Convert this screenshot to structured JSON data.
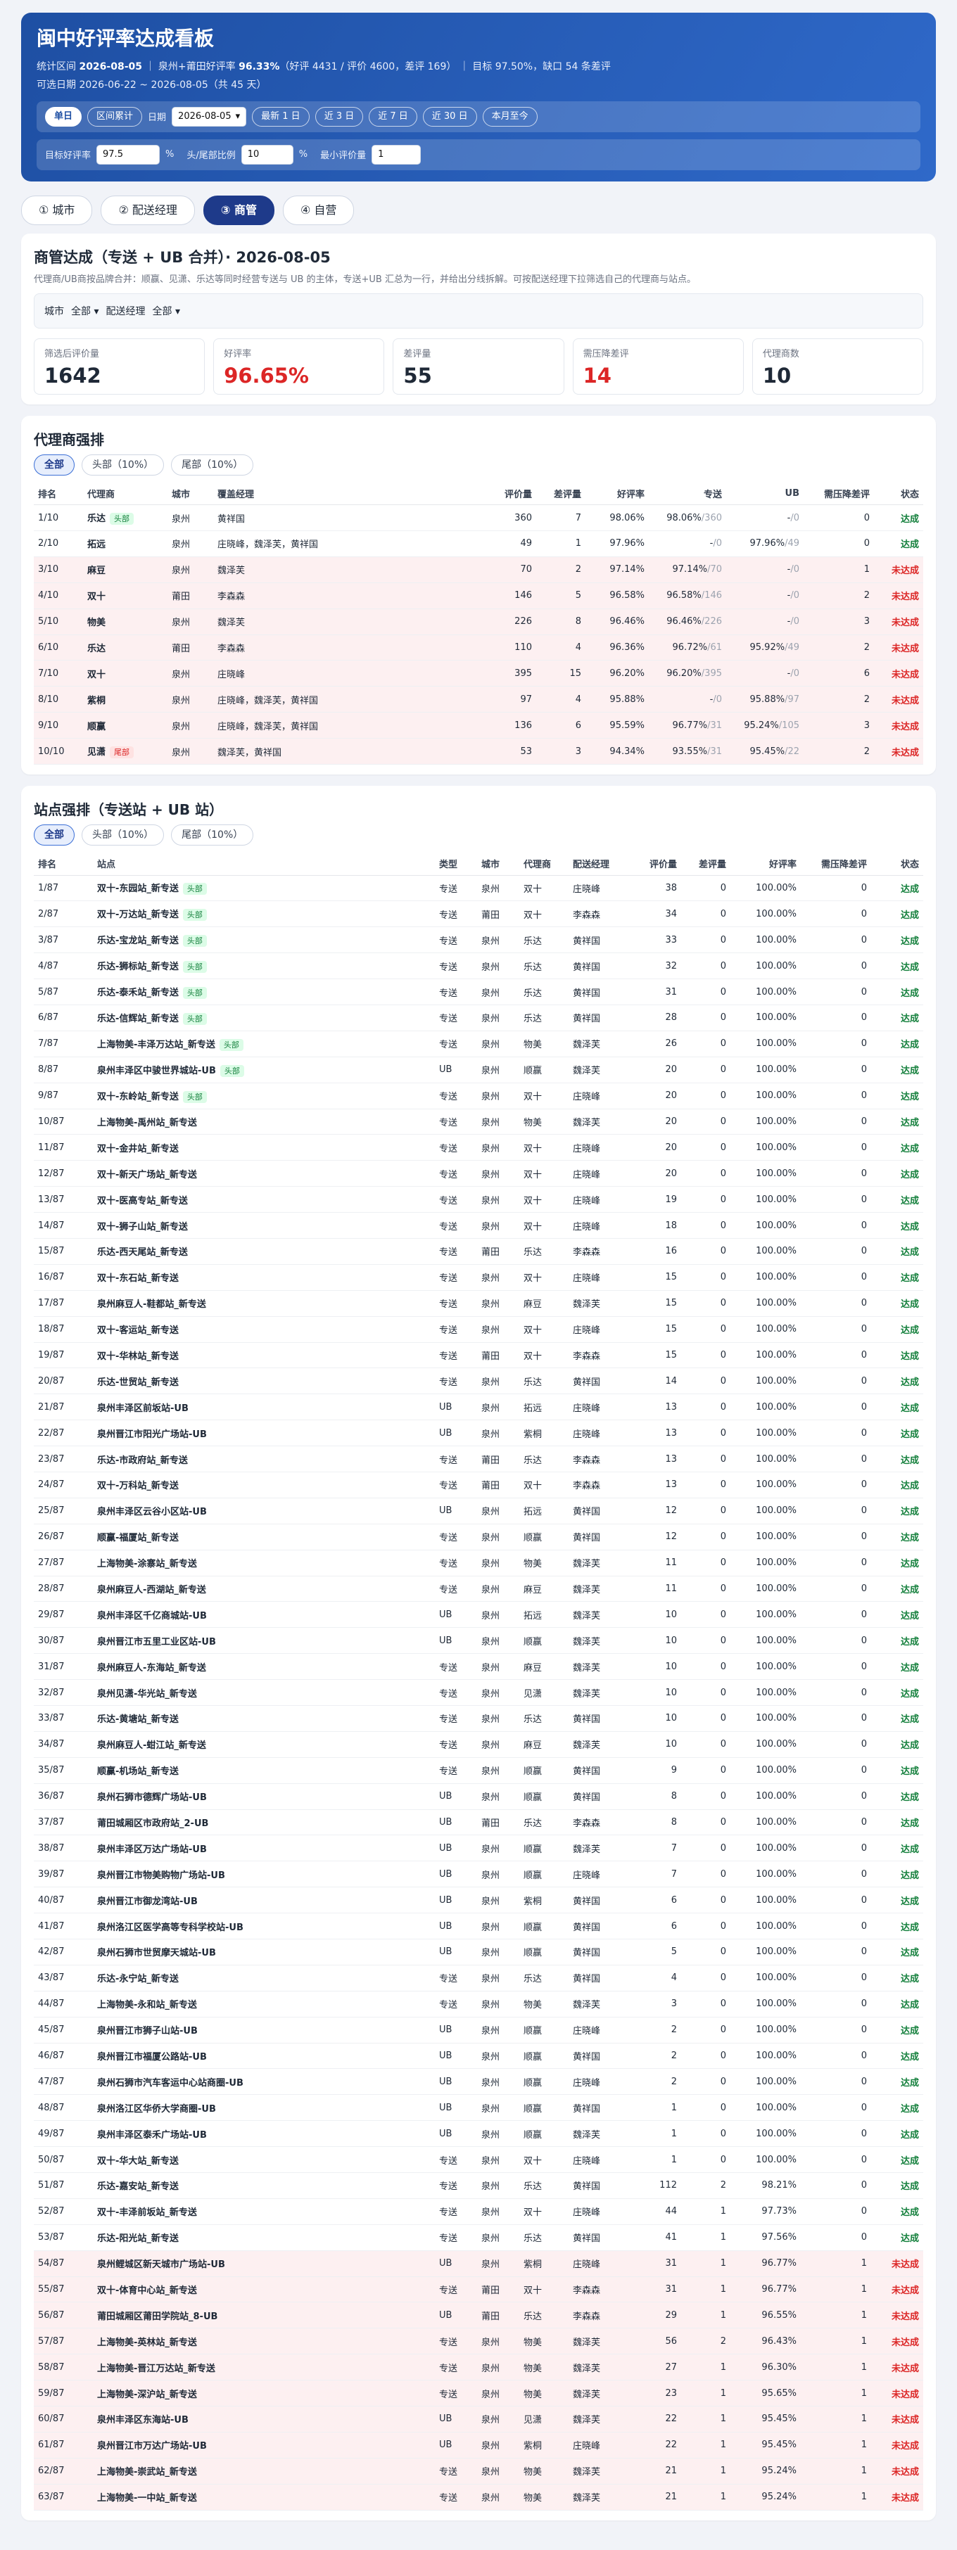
{
  "header": {
    "title": "闽中好评率达成看板",
    "stat_label": "统计区间",
    "stat_date": "2026-08-05",
    "scope_label": "泉州+莆田好评率",
    "rate": "96.33%",
    "rate_detail": "（好评 4431 / 评价 4600，差评 169）",
    "target": "目标 97.50%，缺口 54 条差评",
    "range": "可选日期 2026-06-22 ~ 2026-08-05（共 45 天）"
  },
  "controls": {
    "mode_single": "单日",
    "mode_range": "区间累计",
    "date_label": "日期",
    "date_value": "2026-08-05",
    "quick": [
      "最新 1 日",
      "近 3 日",
      "近 7 日",
      "近 30 日",
      "本月至今"
    ],
    "target_label": "目标好评率",
    "target_value": "97.5",
    "pct": "%",
    "ratio_label": "头/尾部比例",
    "ratio_value": "10",
    "min_label": "最小评价量",
    "min_value": "1"
  },
  "tabs": [
    "① 城市",
    "② 配送经理",
    "③ 商管",
    "④ 自营"
  ],
  "summary": {
    "title": "商管达成（专送 + UB 合并）· 2026-08-05",
    "desc": "代理商/UB商按品牌合并：顺赢、见潇、乐达等同时经营专送与 UB 的主体，专送+UB 汇总为一行，并给出分线拆解。可按配送经理下拉筛选自己的代理商与站点。",
    "city_label": "城市",
    "city_value": "全部",
    "mgr_label": "配送经理",
    "mgr_value": "全部",
    "kpis": [
      {
        "label": "筛选后评价量",
        "value": "1642",
        "red": false
      },
      {
        "label": "好评率",
        "value": "96.65%",
        "red": true
      },
      {
        "label": "差评量",
        "value": "55",
        "red": false
      },
      {
        "label": "需压降差评",
        "value": "14",
        "red": true
      },
      {
        "label": "代理商数",
        "value": "10",
        "red": false
      }
    ]
  },
  "agents": {
    "title": "代理商强排",
    "seg": [
      "全部",
      "头部（10%）",
      "尾部（10%）"
    ],
    "headers": [
      "排名",
      "代理商",
      "城市",
      "覆盖经理",
      "评价量",
      "差评量",
      "好评率",
      "专送",
      "UB",
      "需压降差评",
      "状态"
    ],
    "rows": [
      [
        "1/10",
        "乐达",
        "头部",
        "泉州",
        "黄祥国",
        "360",
        "7",
        "98.06%",
        "98.06%",
        "/360",
        "-",
        "/0",
        "0",
        "达成"
      ],
      [
        "2/10",
        "拓远",
        "",
        "泉州",
        "庄晓峰，魏泽芙，黄祥国",
        "49",
        "1",
        "97.96%",
        "-",
        "/0",
        "97.96%",
        "/49",
        "0",
        "达成"
      ],
      [
        "3/10",
        "麻豆",
        "",
        "泉州",
        "魏泽芙",
        "70",
        "2",
        "97.14%",
        "97.14%",
        "/70",
        "-",
        "/0",
        "1",
        "未达成"
      ],
      [
        "4/10",
        "双十",
        "",
        "莆田",
        "李森森",
        "146",
        "5",
        "96.58%",
        "96.58%",
        "/146",
        "-",
        "/0",
        "2",
        "未达成"
      ],
      [
        "5/10",
        "物美",
        "",
        "泉州",
        "魏泽芙",
        "226",
        "8",
        "96.46%",
        "96.46%",
        "/226",
        "-",
        "/0",
        "3",
        "未达成"
      ],
      [
        "6/10",
        "乐达",
        "",
        "莆田",
        "李森森",
        "110",
        "4",
        "96.36%",
        "96.72%",
        "/61",
        "95.92%",
        "/49",
        "2",
        "未达成"
      ],
      [
        "7/10",
        "双十",
        "",
        "泉州",
        "庄晓峰",
        "395",
        "15",
        "96.20%",
        "96.20%",
        "/395",
        "-",
        "/0",
        "6",
        "未达成"
      ],
      [
        "8/10",
        "紫桐",
        "",
        "泉州",
        "庄晓峰，魏泽芙，黄祥国",
        "97",
        "4",
        "95.88%",
        "-",
        "/0",
        "95.88%",
        "/97",
        "2",
        "未达成"
      ],
      [
        "9/10",
        "顺赢",
        "",
        "泉州",
        "庄晓峰，魏泽芙，黄祥国",
        "136",
        "6",
        "95.59%",
        "96.77%",
        "/31",
        "95.24%",
        "/105",
        "3",
        "未达成"
      ],
      [
        "10/10",
        "见潇",
        "尾部",
        "泉州",
        "魏泽芙，黄祥国",
        "53",
        "3",
        "94.34%",
        "93.55%",
        "/31",
        "95.45%",
        "/22",
        "2",
        "未达成"
      ]
    ]
  },
  "stations": {
    "title": "站点强排（专送站 + UB 站）",
    "seg": [
      "全部",
      "头部（10%）",
      "尾部（10%）"
    ],
    "headers": [
      "排名",
      "站点",
      "类型",
      "城市",
      "代理商",
      "配送经理",
      "评价量",
      "差评量",
      "好评率",
      "需压降差评",
      "状态"
    ],
    "rows": [
      [
        "1/87",
        "双十-东园站_新专送",
        "头部",
        "专送",
        "泉州",
        "双十",
        "庄晓峰",
        "38",
        "0",
        "100.00%",
        "0",
        "达成"
      ],
      [
        "2/87",
        "双十-万达站_新专送",
        "头部",
        "专送",
        "莆田",
        "双十",
        "李森森",
        "34",
        "0",
        "100.00%",
        "0",
        "达成"
      ],
      [
        "3/87",
        "乐达-宝龙站_新专送",
        "头部",
        "专送",
        "泉州",
        "乐达",
        "黄祥国",
        "33",
        "0",
        "100.00%",
        "0",
        "达成"
      ],
      [
        "4/87",
        "乐达-狮标站_新专送",
        "头部",
        "专送",
        "泉州",
        "乐达",
        "黄祥国",
        "32",
        "0",
        "100.00%",
        "0",
        "达成"
      ],
      [
        "5/87",
        "乐达-泰禾站_新专送",
        "头部",
        "专送",
        "泉州",
        "乐达",
        "黄祥国",
        "31",
        "0",
        "100.00%",
        "0",
        "达成"
      ],
      [
        "6/87",
        "乐达-信辉站_新专送",
        "头部",
        "专送",
        "泉州",
        "乐达",
        "黄祥国",
        "28",
        "0",
        "100.00%",
        "0",
        "达成"
      ],
      [
        "7/87",
        "上海物美-丰泽万达站_新专送",
        "头部",
        "专送",
        "泉州",
        "物美",
        "魏泽芙",
        "26",
        "0",
        "100.00%",
        "0",
        "达成"
      ],
      [
        "8/87",
        "泉州丰泽区中骏世界城站-UB",
        "头部",
        "UB",
        "泉州",
        "顺赢",
        "魏泽芙",
        "20",
        "0",
        "100.00%",
        "0",
        "达成"
      ],
      [
        "9/87",
        "双十-东岭站_新专送",
        "头部",
        "专送",
        "泉州",
        "双十",
        "庄晓峰",
        "20",
        "0",
        "100.00%",
        "0",
        "达成"
      ],
      [
        "10/87",
        "上海物美-禹州站_新专送",
        "",
        "专送",
        "泉州",
        "物美",
        "魏泽芙",
        "20",
        "0",
        "100.00%",
        "0",
        "达成"
      ],
      [
        "11/87",
        "双十-金井站_新专送",
        "",
        "专送",
        "泉州",
        "双十",
        "庄晓峰",
        "20",
        "0",
        "100.00%",
        "0",
        "达成"
      ],
      [
        "12/87",
        "双十-新天广场站_新专送",
        "",
        "专送",
        "泉州",
        "双十",
        "庄晓峰",
        "20",
        "0",
        "100.00%",
        "0",
        "达成"
      ],
      [
        "13/87",
        "双十-医高专站_新专送",
        "",
        "专送",
        "泉州",
        "双十",
        "庄晓峰",
        "19",
        "0",
        "100.00%",
        "0",
        "达成"
      ],
      [
        "14/87",
        "双十-狮子山站_新专送",
        "",
        "专送",
        "泉州",
        "双十",
        "庄晓峰",
        "18",
        "0",
        "100.00%",
        "0",
        "达成"
      ],
      [
        "15/87",
        "乐达-西天尾站_新专送",
        "",
        "专送",
        "莆田",
        "乐达",
        "李森森",
        "16",
        "0",
        "100.00%",
        "0",
        "达成"
      ],
      [
        "16/87",
        "双十-东石站_新专送",
        "",
        "专送",
        "泉州",
        "双十",
        "庄晓峰",
        "15",
        "0",
        "100.00%",
        "0",
        "达成"
      ],
      [
        "17/87",
        "泉州麻豆人-鞋都站_新专送",
        "",
        "专送",
        "泉州",
        "麻豆",
        "魏泽芙",
        "15",
        "0",
        "100.00%",
        "0",
        "达成"
      ],
      [
        "18/87",
        "双十-客运站_新专送",
        "",
        "专送",
        "泉州",
        "双十",
        "庄晓峰",
        "15",
        "0",
        "100.00%",
        "0",
        "达成"
      ],
      [
        "19/87",
        "双十-华林站_新专送",
        "",
        "专送",
        "莆田",
        "双十",
        "李森森",
        "15",
        "0",
        "100.00%",
        "0",
        "达成"
      ],
      [
        "20/87",
        "乐达-世贸站_新专送",
        "",
        "专送",
        "泉州",
        "乐达",
        "黄祥国",
        "14",
        "0",
        "100.00%",
        "0",
        "达成"
      ],
      [
        "21/87",
        "泉州丰泽区前坂站-UB",
        "",
        "UB",
        "泉州",
        "拓远",
        "庄晓峰",
        "13",
        "0",
        "100.00%",
        "0",
        "达成"
      ],
      [
        "22/87",
        "泉州晋江市阳光广场站-UB",
        "",
        "UB",
        "泉州",
        "紫桐",
        "庄晓峰",
        "13",
        "0",
        "100.00%",
        "0",
        "达成"
      ],
      [
        "23/87",
        "乐达-市政府站_新专送",
        "",
        "专送",
        "莆田",
        "乐达",
        "李森森",
        "13",
        "0",
        "100.00%",
        "0",
        "达成"
      ],
      [
        "24/87",
        "双十-万科站_新专送",
        "",
        "专送",
        "莆田",
        "双十",
        "李森森",
        "13",
        "0",
        "100.00%",
        "0",
        "达成"
      ],
      [
        "25/87",
        "泉州丰泽区云谷小区站-UB",
        "",
        "UB",
        "泉州",
        "拓远",
        "黄祥国",
        "12",
        "0",
        "100.00%",
        "0",
        "达成"
      ],
      [
        "26/87",
        "顺赢-福厦站_新专送",
        "",
        "专送",
        "泉州",
        "顺赢",
        "黄祥国",
        "12",
        "0",
        "100.00%",
        "0",
        "达成"
      ],
      [
        "27/87",
        "上海物美-涂寨站_新专送",
        "",
        "专送",
        "泉州",
        "物美",
        "魏泽芙",
        "11",
        "0",
        "100.00%",
        "0",
        "达成"
      ],
      [
        "28/87",
        "泉州麻豆人-西湖站_新专送",
        "",
        "专送",
        "泉州",
        "麻豆",
        "魏泽芙",
        "11",
        "0",
        "100.00%",
        "0",
        "达成"
      ],
      [
        "29/87",
        "泉州丰泽区千亿商城站-UB",
        "",
        "UB",
        "泉州",
        "拓远",
        "魏泽芙",
        "10",
        "0",
        "100.00%",
        "0",
        "达成"
      ],
      [
        "30/87",
        "泉州晋江市五里工业区站-UB",
        "",
        "UB",
        "泉州",
        "顺赢",
        "魏泽芙",
        "10",
        "0",
        "100.00%",
        "0",
        "达成"
      ],
      [
        "31/87",
        "泉州麻豆人-东海站_新专送",
        "",
        "专送",
        "泉州",
        "麻豆",
        "魏泽芙",
        "10",
        "0",
        "100.00%",
        "0",
        "达成"
      ],
      [
        "32/87",
        "泉州见潇-华光站_新专送",
        "",
        "专送",
        "泉州",
        "见潇",
        "魏泽芙",
        "10",
        "0",
        "100.00%",
        "0",
        "达成"
      ],
      [
        "33/87",
        "乐达-黄塘站_新专送",
        "",
        "专送",
        "泉州",
        "乐达",
        "黄祥国",
        "10",
        "0",
        "100.00%",
        "0",
        "达成"
      ],
      [
        "34/87",
        "泉州麻豆人-蚶江站_新专送",
        "",
        "专送",
        "泉州",
        "麻豆",
        "魏泽芙",
        "10",
        "0",
        "100.00%",
        "0",
        "达成"
      ],
      [
        "35/87",
        "顺赢-机场站_新专送",
        "",
        "专送",
        "泉州",
        "顺赢",
        "黄祥国",
        "9",
        "0",
        "100.00%",
        "0",
        "达成"
      ],
      [
        "36/87",
        "泉州石狮市德辉广场站-UB",
        "",
        "UB",
        "泉州",
        "顺赢",
        "黄祥国",
        "8",
        "0",
        "100.00%",
        "0",
        "达成"
      ],
      [
        "37/87",
        "莆田城厢区市政府站_2-UB",
        "",
        "UB",
        "莆田",
        "乐达",
        "李森森",
        "8",
        "0",
        "100.00%",
        "0",
        "达成"
      ],
      [
        "38/87",
        "泉州丰泽区万达广场站-UB",
        "",
        "UB",
        "泉州",
        "顺赢",
        "魏泽芙",
        "7",
        "0",
        "100.00%",
        "0",
        "达成"
      ],
      [
        "39/87",
        "泉州晋江市物美购物广场站-UB",
        "",
        "UB",
        "泉州",
        "顺赢",
        "庄晓峰",
        "7",
        "0",
        "100.00%",
        "0",
        "达成"
      ],
      [
        "40/87",
        "泉州晋江市御龙湾站-UB",
        "",
        "UB",
        "泉州",
        "紫桐",
        "黄祥国",
        "6",
        "0",
        "100.00%",
        "0",
        "达成"
      ],
      [
        "41/87",
        "泉州洛江区医学高等专科学校站-UB",
        "",
        "UB",
        "泉州",
        "顺赢",
        "黄祥国",
        "6",
        "0",
        "100.00%",
        "0",
        "达成"
      ],
      [
        "42/87",
        "泉州石狮市世贸摩天城站-UB",
        "",
        "UB",
        "泉州",
        "顺赢",
        "黄祥国",
        "5",
        "0",
        "100.00%",
        "0",
        "达成"
      ],
      [
        "43/87",
        "乐达-永宁站_新专送",
        "",
        "专送",
        "泉州",
        "乐达",
        "黄祥国",
        "4",
        "0",
        "100.00%",
        "0",
        "达成"
      ],
      [
        "44/87",
        "上海物美-永和站_新专送",
        "",
        "专送",
        "泉州",
        "物美",
        "魏泽芙",
        "3",
        "0",
        "100.00%",
        "0",
        "达成"
      ],
      [
        "45/87",
        "泉州晋江市狮子山站-UB",
        "",
        "UB",
        "泉州",
        "顺赢",
        "庄晓峰",
        "2",
        "0",
        "100.00%",
        "0",
        "达成"
      ],
      [
        "46/87",
        "泉州晋江市福厦公路站-UB",
        "",
        "UB",
        "泉州",
        "顺赢",
        "黄祥国",
        "2",
        "0",
        "100.00%",
        "0",
        "达成"
      ],
      [
        "47/87",
        "泉州石狮市汽车客运中心站商圈-UB",
        "",
        "UB",
        "泉州",
        "顺赢",
        "庄晓峰",
        "2",
        "0",
        "100.00%",
        "0",
        "达成"
      ],
      [
        "48/87",
        "泉州洛江区华侨大学商圈-UB",
        "",
        "UB",
        "泉州",
        "顺赢",
        "黄祥国",
        "1",
        "0",
        "100.00%",
        "0",
        "达成"
      ],
      [
        "49/87",
        "泉州丰泽区泰禾广场站-UB",
        "",
        "UB",
        "泉州",
        "顺赢",
        "魏泽芙",
        "1",
        "0",
        "100.00%",
        "0",
        "达成"
      ],
      [
        "50/87",
        "双十-华大站_新专送",
        "",
        "专送",
        "泉州",
        "双十",
        "庄晓峰",
        "1",
        "0",
        "100.00%",
        "0",
        "达成"
      ],
      [
        "51/87",
        "乐达-嘉安站_新专送",
        "",
        "专送",
        "泉州",
        "乐达",
        "黄祥国",
        "112",
        "2",
        "98.21%",
        "0",
        "达成"
      ],
      [
        "52/87",
        "双十-丰泽前坂站_新专送",
        "",
        "专送",
        "泉州",
        "双十",
        "庄晓峰",
        "44",
        "1",
        "97.73%",
        "0",
        "达成"
      ],
      [
        "53/87",
        "乐达-阳光站_新专送",
        "",
        "专送",
        "泉州",
        "乐达",
        "黄祥国",
        "41",
        "1",
        "97.56%",
        "0",
        "达成"
      ],
      [
        "54/87",
        "泉州鲤城区新天城市广场站-UB",
        "",
        "UB",
        "泉州",
        "紫桐",
        "庄晓峰",
        "31",
        "1",
        "96.77%",
        "1",
        "未达成"
      ],
      [
        "55/87",
        "双十-体育中心站_新专送",
        "",
        "专送",
        "莆田",
        "双十",
        "李森森",
        "31",
        "1",
        "96.77%",
        "1",
        "未达成"
      ],
      [
        "56/87",
        "莆田城厢区莆田学院站_8-UB",
        "",
        "UB",
        "莆田",
        "乐达",
        "李森森",
        "29",
        "1",
        "96.55%",
        "1",
        "未达成"
      ],
      [
        "57/87",
        "上海物美-英林站_新专送",
        "",
        "专送",
        "泉州",
        "物美",
        "魏泽芙",
        "56",
        "2",
        "96.43%",
        "1",
        "未达成"
      ],
      [
        "58/87",
        "上海物美-晋江万达站_新专送",
        "",
        "专送",
        "泉州",
        "物美",
        "魏泽芙",
        "27",
        "1",
        "96.30%",
        "1",
        "未达成"
      ],
      [
        "59/87",
        "上海物美-深沪站_新专送",
        "",
        "专送",
        "泉州",
        "物美",
        "魏泽芙",
        "23",
        "1",
        "95.65%",
        "1",
        "未达成"
      ],
      [
        "60/87",
        "泉州丰泽区东海站-UB",
        "",
        "UB",
        "泉州",
        "见潇",
        "魏泽芙",
        "22",
        "1",
        "95.45%",
        "1",
        "未达成"
      ],
      [
        "61/87",
        "泉州晋江市万达广场站-UB",
        "",
        "UB",
        "泉州",
        "紫桐",
        "庄晓峰",
        "22",
        "1",
        "95.45%",
        "1",
        "未达成"
      ],
      [
        "62/87",
        "上海物美-崇武站_新专送",
        "",
        "专送",
        "泉州",
        "物美",
        "魏泽芙",
        "21",
        "1",
        "95.24%",
        "1",
        "未达成"
      ],
      [
        "63/87",
        "上海物美-一中站_新专送",
        "",
        "专送",
        "泉州",
        "物美",
        "魏泽芙",
        "21",
        "1",
        "95.24%",
        "1",
        "未达成"
      ]
    ]
  }
}
